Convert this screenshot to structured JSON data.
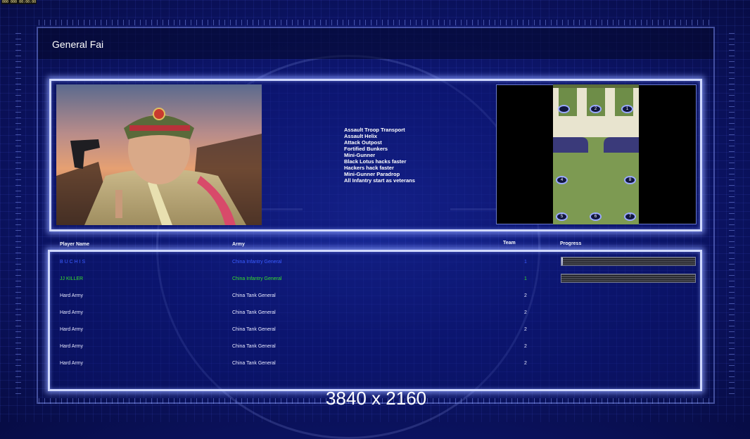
{
  "overlay": {
    "fps_text": "000  000 00:00:00"
  },
  "title": "General Fai",
  "abilities": [
    "Assault Troop Transport",
    "Assault Helix",
    "Attack Outpost",
    "Fortified Bunkers",
    "Mini-Gunner",
    "Black Lotus hacks faster",
    "Hackers hack faster",
    "Mini-Gunner Paradrop",
    "All Infantry start as veterans"
  ],
  "map": {
    "spots": [
      "2",
      "1",
      "4",
      "8",
      "5",
      "6",
      "7"
    ]
  },
  "headers": {
    "player": "Player Name",
    "army": "Army",
    "team": "Team",
    "progress": "Progress"
  },
  "players": [
    {
      "name": "B U C H I S",
      "army": "China Infantry General",
      "team": "1",
      "color": "#3a5cff",
      "progress": 0.01
    },
    {
      "name": "JJ KILLER",
      "army": "China Infantry General",
      "team": "1",
      "color": "#36e02a",
      "progress": 0.0
    },
    {
      "name": "Hard Army",
      "army": "China Tank General",
      "team": "2",
      "color": "#e6e8ff"
    },
    {
      "name": "Hard Army",
      "army": "China Tank General",
      "team": "2",
      "color": "#e6e8ff"
    },
    {
      "name": "Hard Army",
      "army": "China Tank General",
      "team": "2",
      "color": "#e6e8ff"
    },
    {
      "name": "Hard Army",
      "army": "China Tank General",
      "team": "2",
      "color": "#e6e8ff"
    },
    {
      "name": "Hard Army",
      "army": "China Tank General",
      "team": "2",
      "color": "#e6e8ff"
    }
  ],
  "resolution_label": "3840 x 2160"
}
